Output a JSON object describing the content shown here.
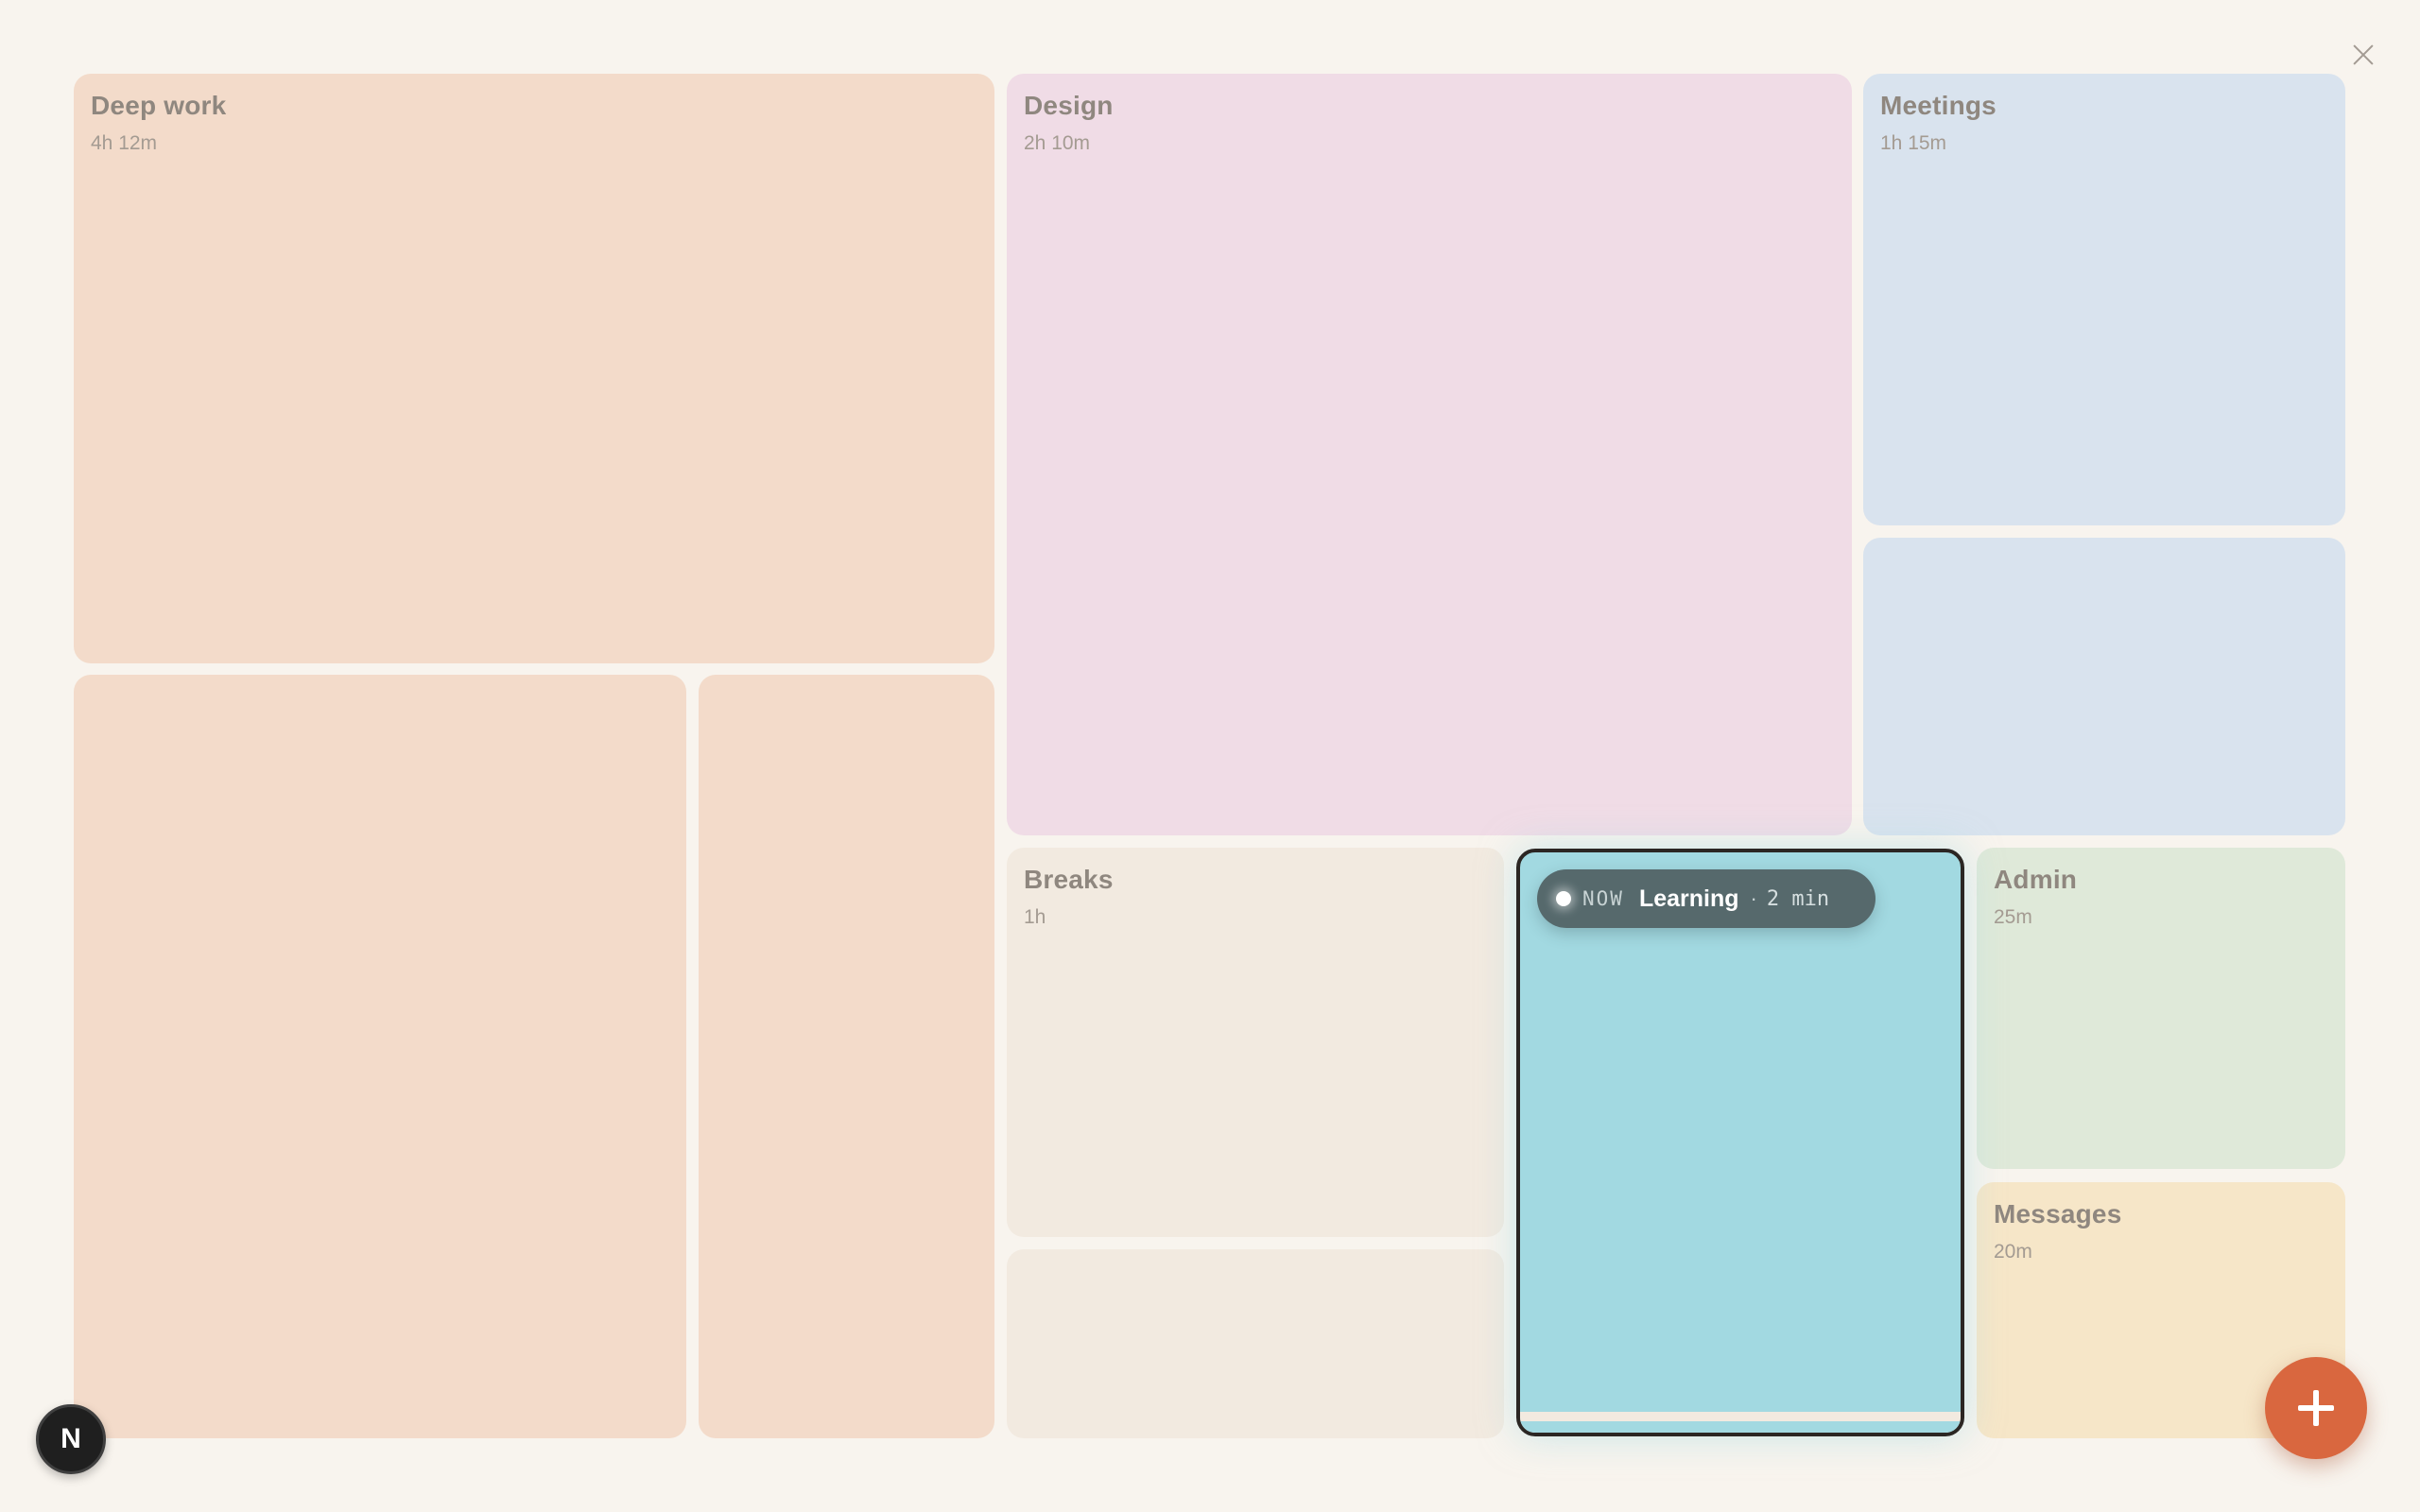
{
  "categories": [
    {
      "name": "Deep work",
      "duration": "4h 12m"
    },
    {
      "name": "Design",
      "duration": "2h 10m"
    },
    {
      "name": "Meetings",
      "duration": "1h 15m"
    },
    {
      "name": "Breaks",
      "duration": "1h"
    },
    {
      "name": "Admin",
      "duration": "25m"
    },
    {
      "name": "Messages",
      "duration": "20m"
    }
  ],
  "now": {
    "tag": "NOW",
    "title": "Learning",
    "separator": "·",
    "elapsed": "2 min"
  },
  "avatar": {
    "initial": "N"
  },
  "colors": {
    "deep_work": "#f3dbca",
    "design": "#f0dce6",
    "meetings": "#d9e3ee",
    "breaks": "#f2eae0",
    "learning": "#a2d9e1",
    "admin": "#dfe9d9",
    "messages": "#f6e6c8",
    "accent": "#d9673f"
  },
  "icons": {
    "close": "close-icon",
    "add": "plus-icon"
  }
}
